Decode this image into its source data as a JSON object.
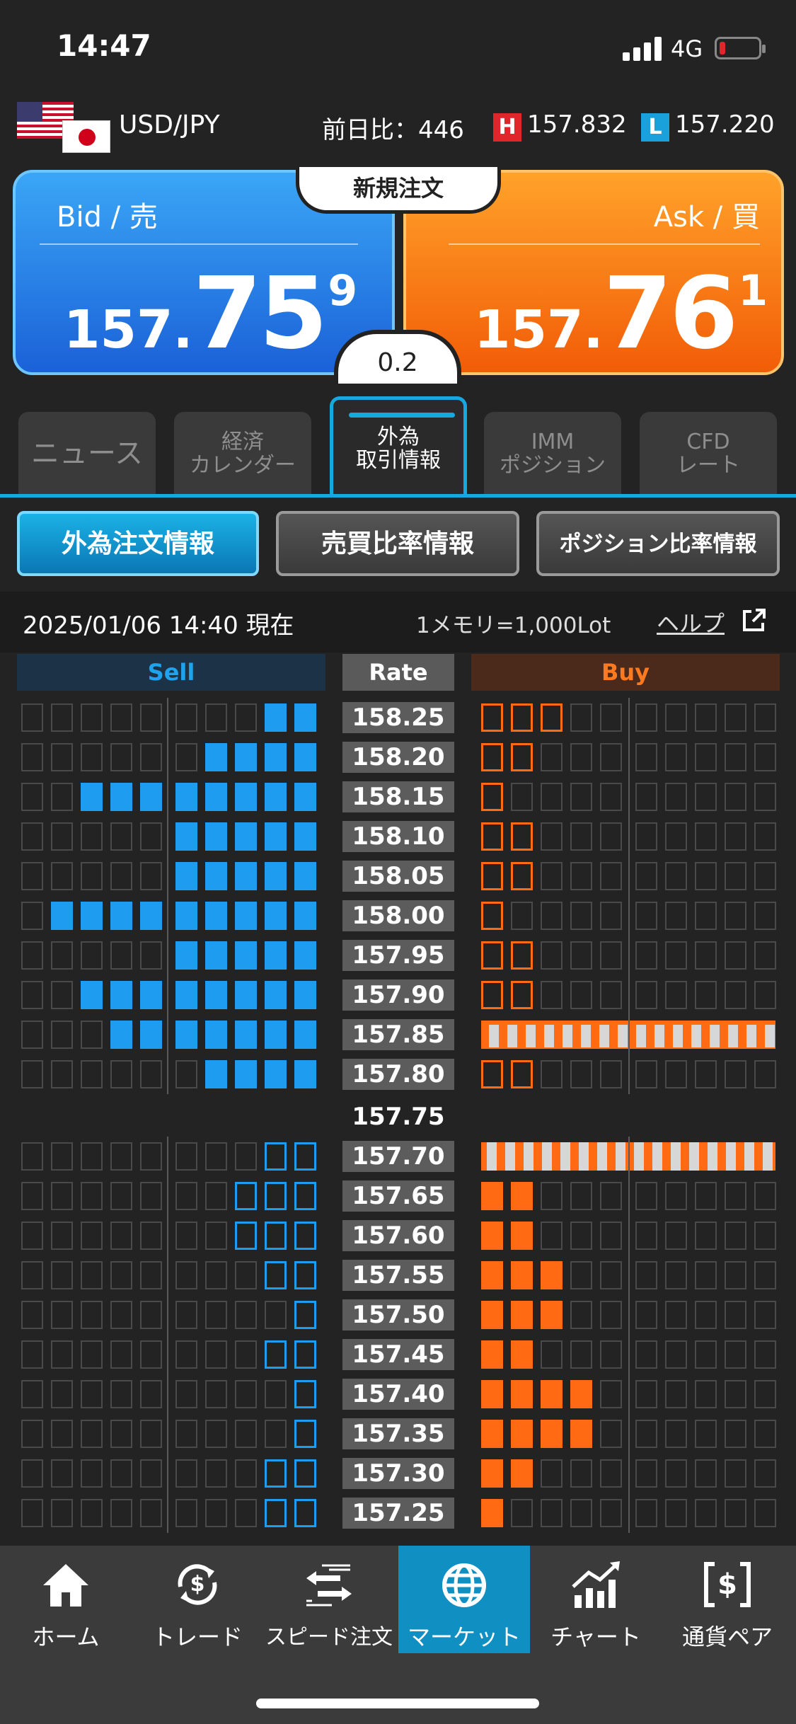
{
  "status": {
    "time": "14:47",
    "network": "4G"
  },
  "header": {
    "pair": "USD/JPY",
    "prev_diff_label": "前日比：446",
    "high_badge": "H",
    "high": "157.832",
    "low_badge": "L",
    "low": "157.220"
  },
  "bid": {
    "label": "Bid / 売",
    "small": "157.",
    "big": "75",
    "sup": "9"
  },
  "ask": {
    "label": "Ask / 買",
    "small": "157.",
    "big": "76",
    "sup": "1"
  },
  "new_order_label": "新規注文",
  "spread": "0.2",
  "tabs": [
    {
      "label": "ニュース"
    },
    {
      "label": "経済\nカレンダー"
    },
    {
      "label": "外為\n取引情報"
    },
    {
      "label": "IMM\nポジション"
    },
    {
      "label": "CFD\nレート"
    }
  ],
  "subtabs": [
    {
      "label": "外為注文情報"
    },
    {
      "label": "売買比率情報"
    },
    {
      "label": "ポジション比率情報"
    }
  ],
  "info": {
    "datetime": "2025/01/06 14:40 現在",
    "lot": "1メモリ=1,000Lot",
    "help": "ヘルプ"
  },
  "board": {
    "headers": {
      "sell": "Sell",
      "rate": "Rate",
      "buy": "Buy"
    },
    "current_rate": "157.75",
    "upper_rows": [
      {
        "rate": "158.25",
        "sell": 2,
        "buy": 3
      },
      {
        "rate": "158.20",
        "sell": 4,
        "buy": 2
      },
      {
        "rate": "158.15",
        "sell": 8,
        "buy": 1
      },
      {
        "rate": "158.10",
        "sell": 5,
        "buy": 2
      },
      {
        "rate": "158.05",
        "sell": 5,
        "buy": 2
      },
      {
        "rate": "158.00",
        "sell": 9,
        "buy": 1
      },
      {
        "rate": "157.95",
        "sell": 5,
        "buy": 2
      },
      {
        "rate": "157.90",
        "sell": 8,
        "buy": 2
      },
      {
        "rate": "157.85",
        "sell": 7,
        "buy": 16
      },
      {
        "rate": "157.80",
        "sell": 4,
        "buy": 2
      }
    ],
    "lower_rows": [
      {
        "rate": "157.70",
        "sell": 2,
        "buy": 16
      },
      {
        "rate": "157.65",
        "sell": 3,
        "buy": 2
      },
      {
        "rate": "157.60",
        "sell": 3,
        "buy": 2
      },
      {
        "rate": "157.55",
        "sell": 2,
        "buy": 3
      },
      {
        "rate": "157.50",
        "sell": 1,
        "buy": 3
      },
      {
        "rate": "157.45",
        "sell": 2,
        "buy": 2
      },
      {
        "rate": "157.40",
        "sell": 1,
        "buy": 4
      },
      {
        "rate": "157.35",
        "sell": 1,
        "buy": 4
      },
      {
        "rate": "157.30",
        "sell": 2,
        "buy": 2
      },
      {
        "rate": "157.25",
        "sell": 2,
        "buy": 1
      }
    ]
  },
  "nav": [
    {
      "label": "ホーム",
      "icon": "home-icon"
    },
    {
      "label": "トレード",
      "icon": "trade-icon"
    },
    {
      "label": "スピード注文",
      "icon": "speed-order-icon"
    },
    {
      "label": "マーケット",
      "icon": "globe-icon"
    },
    {
      "label": "チャート",
      "icon": "chart-icon"
    },
    {
      "label": "通貨ペア",
      "icon": "currency-pair-icon"
    }
  ],
  "colors": {
    "sell": "#1e9df0",
    "buy": "#ff6a13",
    "accent": "#17a8df",
    "high": "#e0252b",
    "low": "#1aa1dc"
  }
}
